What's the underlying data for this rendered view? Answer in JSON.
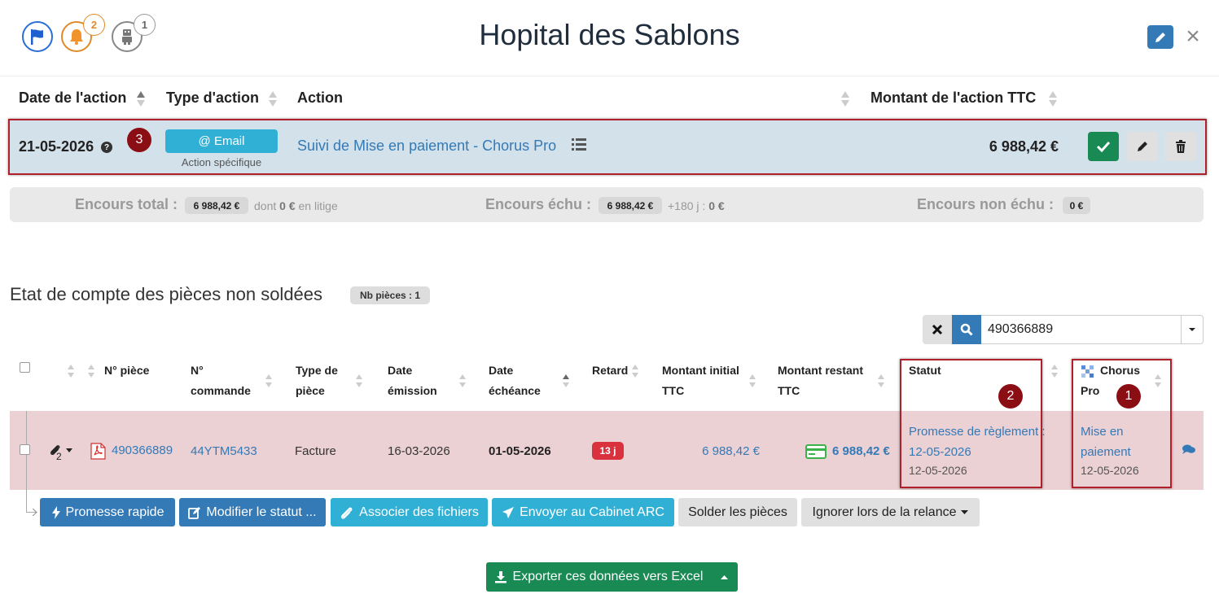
{
  "header": {
    "title": "Hopital des Sablons",
    "bell_count": "2",
    "robot_count": "1",
    "icons": [
      "flag-icon",
      "bell-icon",
      "robot-icon",
      "pencil-icon",
      "close-icon"
    ],
    "close_glyph": "×"
  },
  "action_table": {
    "columns": [
      "Date de l'action",
      "Type d'action",
      "Action",
      "Montant de l'action TTC"
    ],
    "row": {
      "date": "21-05-2026",
      "help_glyph": "?",
      "type_label": "@ Email",
      "type_sub": "Action spécifique",
      "action": "Suivi de Mise en paiement - Chorus Pro",
      "amount": "6 988,42 €"
    },
    "marker": "3"
  },
  "encours": {
    "total_label": "Encours total :",
    "total_value": "6 988,42 €",
    "total_dont": "dont",
    "total_litige_value": "0 €",
    "total_litige_suffix": "en litige",
    "echu_label": "Encours échu :",
    "echu_value": "6 988,42 €",
    "echu_180": "+180 j :",
    "echu_180_value": "0 €",
    "non_echu_label": "Encours non échu :",
    "non_echu_value": "0 €"
  },
  "section": {
    "title": "Etat de compte des pièces non soldées",
    "nb_pieces": "Nb pièces : 1"
  },
  "search": {
    "value": "490366889",
    "placeholder": ""
  },
  "grid": {
    "headers": {
      "piece": "N° pièce",
      "commande_1": "N°",
      "commande_2": "commande",
      "type_1": "Type de",
      "type_2": "pièce",
      "emission_1": "Date",
      "emission_2": "émission",
      "echeance_1": "Date",
      "echeance_2": "échéance",
      "retard": "Retard",
      "initial_1": "Montant initial",
      "initial_2": "TTC",
      "restant_1": "Montant restant",
      "restant_2": "TTC",
      "statut": "Statut",
      "chorus_1": "Chorus",
      "chorus_2": "Pro"
    },
    "row": {
      "attach_count": "2",
      "piece": "490366889",
      "commande": "44YTM5433",
      "type": "Facture",
      "emission": "16-03-2026",
      "echeance": "01-05-2026",
      "retard": "13 j",
      "initial": "6 988,42 €",
      "restant": "6 988,42 €",
      "statut_line1": "Promesse de règlement :",
      "statut_line2": "12-05-2026",
      "statut_date": "12-05-2026",
      "chorus_line1": "Mise en",
      "chorus_line2": "paiement",
      "chorus_date": "12-05-2026"
    },
    "markers": [
      "2",
      "1"
    ]
  },
  "bulk_actions": {
    "promesse": "Promesse rapide",
    "modifier": "Modifier le statut ...",
    "associer": "Associer des fichiers",
    "envoyer": "Envoyer au Cabinet ARC",
    "solder": "Solder les pièces",
    "ignorer": "Ignorer lors de la relance"
  },
  "export": {
    "label": "Exporter ces données vers Excel"
  },
  "colors": {
    "primary": "#337ab7",
    "info": "#31b0d5",
    "success": "#1a8a55",
    "danger": "#d9323e",
    "marker": "#8b0e14",
    "row_blue": "#d3e1ea",
    "row_pink": "#ebd0d4"
  }
}
